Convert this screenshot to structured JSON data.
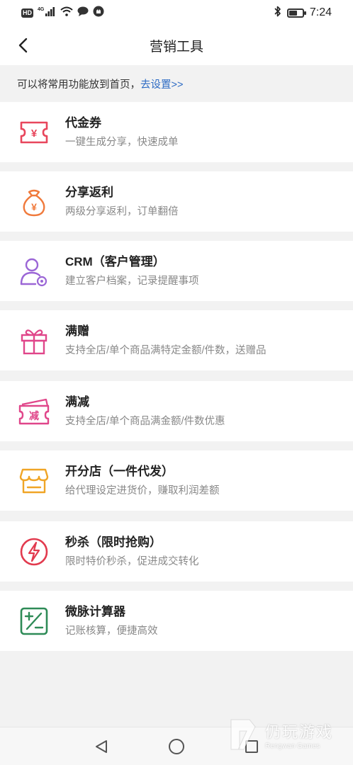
{
  "status_bar": {
    "hd_label": "HD",
    "network_label": "4G",
    "time": "7:24"
  },
  "header": {
    "title": "营销工具"
  },
  "tip": {
    "text": "可以将常用功能放到首页，",
    "link": "去设置>>"
  },
  "tools": [
    {
      "title": "代金券",
      "desc": "一键生成分享，快速成单",
      "icon": "voucher-icon",
      "color": "#e8465c"
    },
    {
      "title": "分享返利",
      "desc": "两级分享返利，订单翻倍",
      "icon": "money-bag-icon",
      "color": "#f07a3c"
    },
    {
      "title": "CRM（客户管理）",
      "desc": "建立客户档案，记录提醒事项",
      "icon": "customer-settings-icon",
      "color": "#9b66d6"
    },
    {
      "title": "满赠",
      "desc": "支持全店/单个商品满特定金额/件数，送赠品",
      "icon": "gift-icon",
      "color": "#e0468a"
    },
    {
      "title": "满减",
      "desc": "支持全店/单个商品满金额/件数优惠",
      "icon": "discount-ticket-icon",
      "color": "#e0468a",
      "icon_text": "减"
    },
    {
      "title": "开分店（一件代发）",
      "desc": "给代理设定进货价，赚取利润差额",
      "icon": "store-icon",
      "color": "#f0a526"
    },
    {
      "title": "秒杀（限时抢购）",
      "desc": "限时特价秒杀，促进成交转化",
      "icon": "lightning-icon",
      "color": "#e23a4e"
    },
    {
      "title": "微脉计算器",
      "desc": "记账核算，便捷高效",
      "icon": "calculator-icon",
      "color": "#2e8b57"
    }
  ],
  "watermark": {
    "main": "仍玩游戏",
    "sub": "Rengwan Games"
  },
  "battery_level": 0.6
}
